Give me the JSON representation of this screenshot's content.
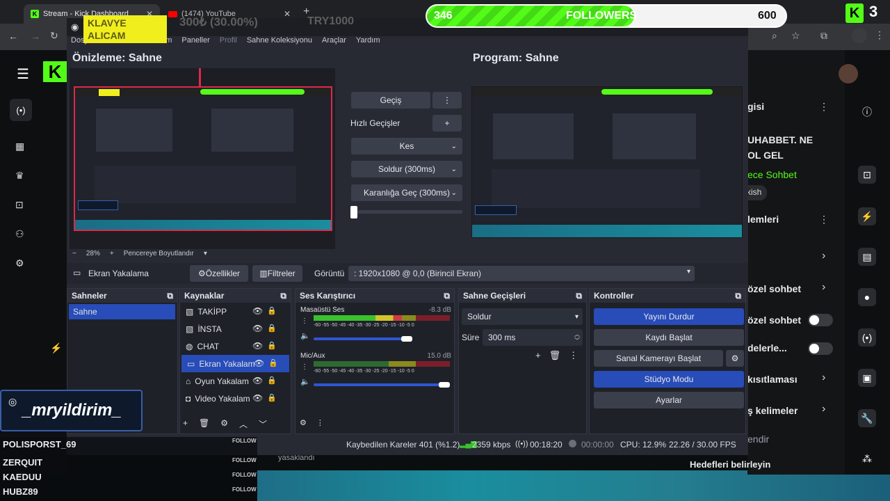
{
  "browser": {
    "tabs": [
      {
        "label": "Stream - Kick Dashboard",
        "active": true
      },
      {
        "label": "(1474) YouTube",
        "active": false
      }
    ],
    "new_tab": "+"
  },
  "overlay": {
    "klavye_text": "KLAVYE ALICAM",
    "price_text": "300₺ (30.00%)",
    "code_text": "TRY1000",
    "followers": {
      "current": "346",
      "label": "FOLLOWERS",
      "goal": "600",
      "progress": 0.577
    },
    "kick_count": "3",
    "instagram_handle": "_mryildirim_",
    "followers_list": [
      {
        "name": "POLISPORST_69",
        "tag": "FOLLOW"
      },
      {
        "name": "ZERQUIT",
        "tag": "FOLLOW"
      },
      {
        "name": "KAEDUU",
        "tag": "FOLLOW"
      },
      {
        "name": "HUBZ89",
        "tag": "FOLLOW"
      }
    ]
  },
  "kick": {
    "right_panel": [
      {
        "text": "gisi"
      },
      {
        "text": "UHABBET. NE"
      },
      {
        "text": "OL GEL"
      },
      {
        "text": "ece Sohbet"
      },
      {
        "text": "kish"
      },
      {
        "text": "lemleri"
      },
      {
        "text": "özel sohbet"
      },
      {
        "text": "özel sohbet"
      },
      {
        "text": "delerle..."
      },
      {
        "text": "kısıtlaması"
      },
      {
        "text": "ş kelimeler"
      },
      {
        "text": "endir"
      },
      {
        "text": "Hedefleri belirleyin"
      }
    ]
  },
  "obs": {
    "menu": [
      "Dosya",
      "Düzenle",
      "Görünüm",
      "Paneller",
      "Profil",
      "Sahne Koleksiyonu",
      "Araçlar",
      "Yardım"
    ],
    "preview_label": "Önizleme: Sahne",
    "program_label": "Program: Sahne",
    "zoom": "28%",
    "zoom_mode": "Pencereye Boyutlandır",
    "transition": {
      "main_button": "Geçiş",
      "quick_label": "Hızlı Geçişler",
      "options": [
        "Kes",
        "Soldur (300ms)",
        "Karanlığa Geç (300ms)"
      ]
    },
    "source_toolbar": {
      "selected": "Ekran Yakalama",
      "properties": "Özellikler",
      "filters": "Filtreler",
      "display_label": "Görüntü",
      "display_value": ": 1920x1080 @ 0,0 (Birincil Ekran)"
    },
    "scenes": {
      "title": "Sahneler",
      "items": [
        "Sahne"
      ]
    },
    "sources": {
      "title": "Kaynaklar",
      "items": [
        "TAKİPP",
        "İNSTA",
        "CHAT",
        "Ekran Yakalam",
        "Oyun Yakalam",
        "Video Yakalam"
      ]
    },
    "mixer": {
      "title": "Ses Karıştırıcı",
      "channels": [
        {
          "name": "Masaüstü Ses",
          "db": "-8.3 dB",
          "volume": 0.9
        },
        {
          "name": "Mic/Aux",
          "db": "15.0 dB",
          "volume": 1.0
        }
      ],
      "scale": "-60 -55 -50 -45 -40 -35 -30 -25 -20 -15 -10 -5 0"
    },
    "scene_transitions": {
      "title": "Sahne Geçişleri",
      "value": "Soldur",
      "duration_label": "Süre",
      "duration": "300 ms"
    },
    "controls": {
      "title": "Kontroller",
      "buttons": [
        "Yayını Durdur",
        "Kaydı Başlat",
        "Sanal Kamerayı Başlat",
        "Stüdyo Modu",
        "Ayarlar"
      ]
    },
    "status": {
      "dropped": "Kaybedilen Kareler 401 (%1.2)",
      "bitrate": "2359 kbps",
      "live_time": "00:18:20",
      "rec_time": "00:00:00",
      "cpu": "CPU: 12.9%",
      "fps": "22.26 / 30.00 FPS"
    }
  },
  "background_text": {
    "muted": "yasaklandı"
  },
  "colors": {
    "kick_green": "#53fc18",
    "obs_blue": "#284cb8",
    "obs_bg": "#272a33"
  }
}
